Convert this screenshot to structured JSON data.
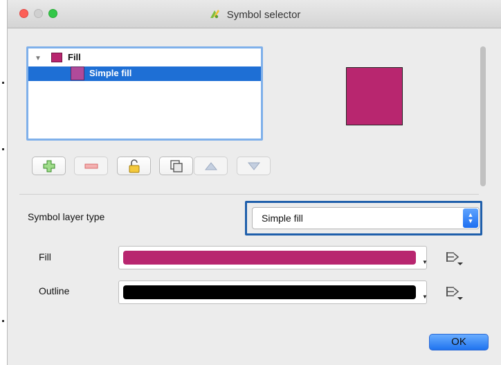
{
  "window": {
    "title": "Symbol selector"
  },
  "tree": {
    "items": [
      {
        "label": "Fill",
        "color": "#b8266f",
        "expanded": true,
        "selected": false
      },
      {
        "label": "Simple fill",
        "color": "#b04a9a",
        "selected": true
      }
    ]
  },
  "preview": {
    "color": "#b8266f"
  },
  "toolbar": {
    "buttons": [
      {
        "icon": "add-icon"
      },
      {
        "icon": "remove-icon"
      },
      {
        "icon": "lock-icon"
      },
      {
        "icon": "duplicate-icon"
      },
      {
        "icon": "move-up-icon"
      },
      {
        "icon": "move-down-icon"
      }
    ]
  },
  "symbol_layer_type": {
    "label": "Symbol layer type",
    "value": "Simple fill"
  },
  "fill": {
    "label": "Fill",
    "color": "#b8266f"
  },
  "outline": {
    "label": "Outline",
    "color": "#000000"
  },
  "ok_label": "OK"
}
